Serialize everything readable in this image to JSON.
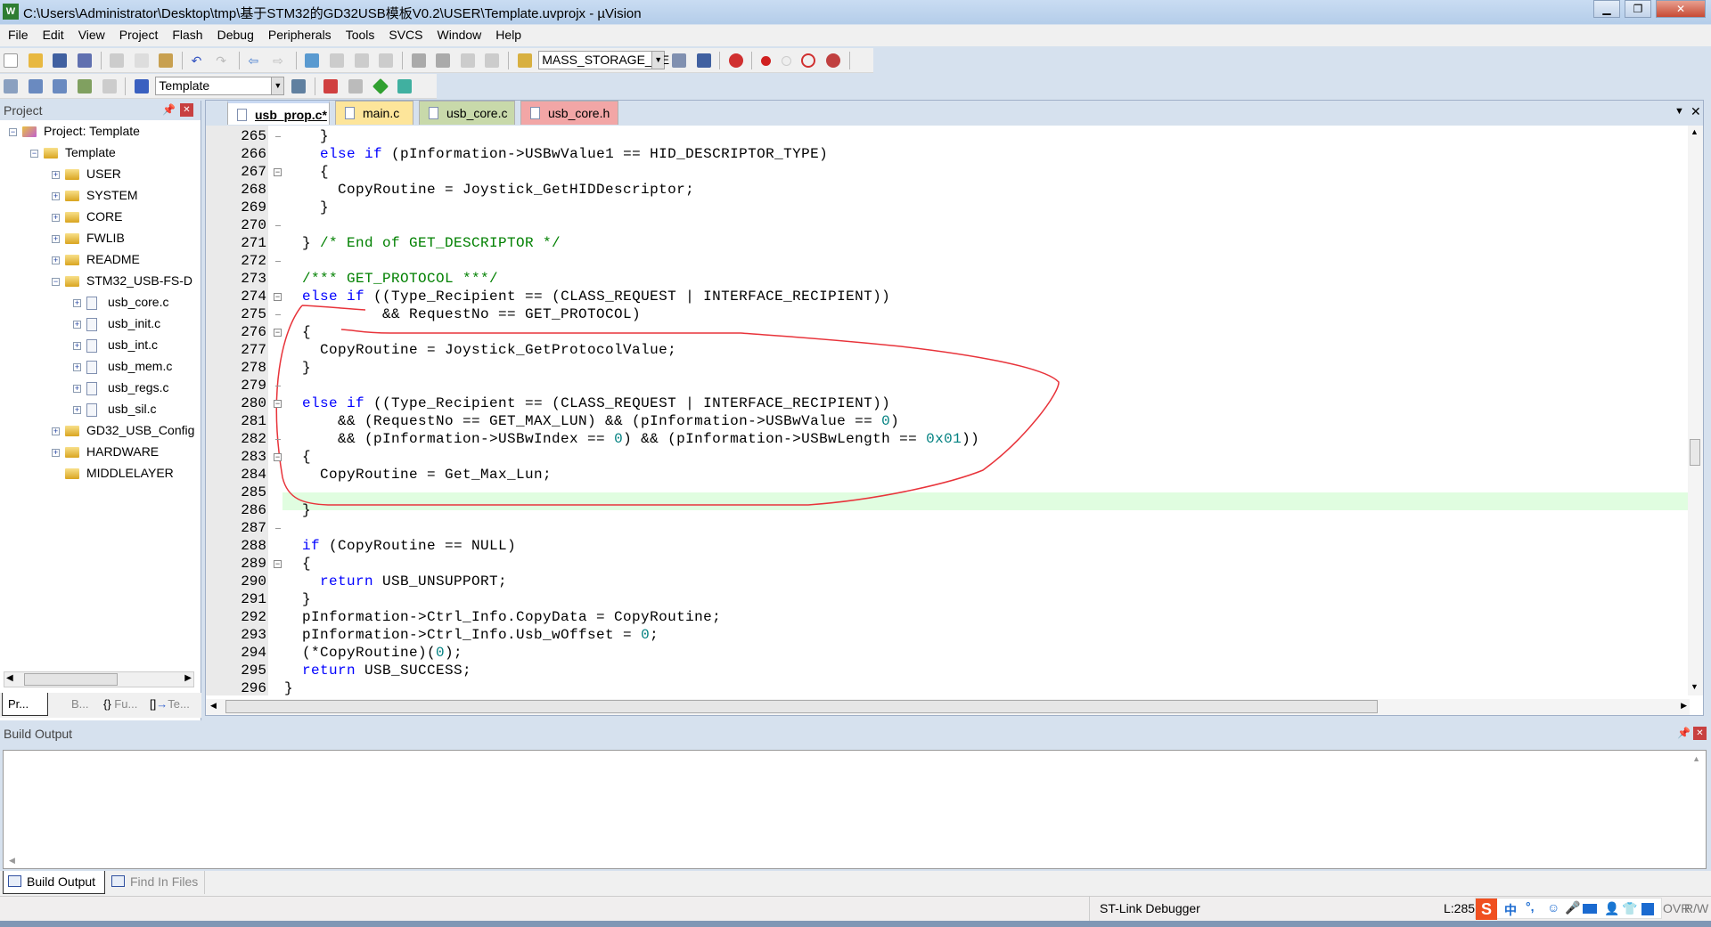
{
  "window": {
    "title": "C:\\Users\\Administrator\\Desktop\\tmp\\基于STM32的GD32USB模板V0.2\\USER\\Template.uvprojx - µVision",
    "app_icon": "W"
  },
  "menu": [
    "File",
    "Edit",
    "View",
    "Project",
    "Flash",
    "Debug",
    "Peripherals",
    "Tools",
    "SVCS",
    "Window",
    "Help"
  ],
  "toolbar": {
    "target_combo": "MASS_STORAGE_RE",
    "project_combo": "Template"
  },
  "project_panel": {
    "title": "Project",
    "tree": [
      {
        "label": "Project: Template",
        "level": 0,
        "expander": "−",
        "icon": "project"
      },
      {
        "label": "Template",
        "level": 1,
        "expander": "−",
        "icon": "folder"
      },
      {
        "label": "USER",
        "level": 2,
        "expander": "+",
        "icon": "folder"
      },
      {
        "label": "SYSTEM",
        "level": 2,
        "expander": "+",
        "icon": "folder"
      },
      {
        "label": "CORE",
        "level": 2,
        "expander": "+",
        "icon": "folder"
      },
      {
        "label": "FWLIB",
        "level": 2,
        "expander": "+",
        "icon": "folder"
      },
      {
        "label": "README",
        "level": 2,
        "expander": "+",
        "icon": "folder"
      },
      {
        "label": "STM32_USB-FS-D",
        "level": 2,
        "expander": "−",
        "icon": "folder"
      },
      {
        "label": "usb_core.c",
        "level": 3,
        "expander": "+",
        "icon": "file"
      },
      {
        "label": "usb_init.c",
        "level": 3,
        "expander": "+",
        "icon": "file"
      },
      {
        "label": "usb_int.c",
        "level": 3,
        "expander": "+",
        "icon": "file"
      },
      {
        "label": "usb_mem.c",
        "level": 3,
        "expander": "+",
        "icon": "file"
      },
      {
        "label": "usb_regs.c",
        "level": 3,
        "expander": "+",
        "icon": "file"
      },
      {
        "label": "usb_sil.c",
        "level": 3,
        "expander": "+",
        "icon": "file"
      },
      {
        "label": "GD32_USB_Config",
        "level": 2,
        "expander": "+",
        "icon": "folder"
      },
      {
        "label": "HARDWARE",
        "level": 2,
        "expander": "+",
        "icon": "folder"
      },
      {
        "label": "MIDDLELAYER",
        "level": 2,
        "expander": "",
        "icon": "folder"
      }
    ],
    "tabs": [
      "Pr...",
      "B...",
      "Fu...",
      "Te..."
    ]
  },
  "editor": {
    "tabs": [
      {
        "label": "usb_prop.c*",
        "color": "#c9d9f2",
        "active": true
      },
      {
        "label": "main.c",
        "color": "#fde59a"
      },
      {
        "label": "usb_core.c",
        "color": "#c8d9aa"
      },
      {
        "label": "usb_core.h",
        "color": "#f2a6a6"
      }
    ],
    "current_line": 285,
    "lines": [
      {
        "n": "265",
        "fold": "tick",
        "t": [
          [
            "",
            "    }"
          ]
        ]
      },
      {
        "n": "266",
        "t": [
          [
            "",
            "    "
          ],
          [
            "kw",
            "else if"
          ],
          [
            "",
            " (pInformation->USBwValue1 == HID_DESCRIPTOR_TYPE)"
          ]
        ]
      },
      {
        "n": "267",
        "fold": "box",
        "t": [
          [
            "",
            "    {"
          ]
        ]
      },
      {
        "n": "268",
        "t": [
          [
            "",
            "      CopyRoutine = Joystick_GetHIDDescriptor;"
          ]
        ]
      },
      {
        "n": "269",
        "t": [
          [
            "",
            "    }"
          ]
        ]
      },
      {
        "n": "270",
        "fold": "tick",
        "t": []
      },
      {
        "n": "271",
        "t": [
          [
            "",
            "  } "
          ],
          [
            "cm",
            "/* End of GET_DESCRIPTOR */"
          ]
        ]
      },
      {
        "n": "272",
        "fold": "tick",
        "t": []
      },
      {
        "n": "273",
        "t": [
          [
            "",
            "  "
          ],
          [
            "cm",
            "/*** GET_PROTOCOL ***/"
          ]
        ]
      },
      {
        "n": "274",
        "fold": "box",
        "t": [
          [
            "",
            "  "
          ],
          [
            "kw",
            "else if"
          ],
          [
            "",
            " ((Type_Recipient == (CLASS_REQUEST | INTERFACE_RECIPIENT))"
          ]
        ]
      },
      {
        "n": "275",
        "fold": "tick",
        "t": [
          [
            "",
            "           && RequestNo == GET_PROTOCOL)"
          ]
        ]
      },
      {
        "n": "276",
        "fold": "box",
        "t": [
          [
            "",
            "  {"
          ]
        ]
      },
      {
        "n": "277",
        "t": [
          [
            "",
            "    CopyRoutine = Joystick_GetProtocolValue;"
          ]
        ]
      },
      {
        "n": "278",
        "t": [
          [
            "",
            "  }"
          ]
        ]
      },
      {
        "n": "279",
        "fold": "tick",
        "t": []
      },
      {
        "n": "280",
        "fold": "box",
        "t": [
          [
            "",
            "  "
          ],
          [
            "kw",
            "else if"
          ],
          [
            "",
            " ((Type_Recipient == (CLASS_REQUEST | INTERFACE_RECIPIENT))"
          ]
        ]
      },
      {
        "n": "281",
        "t": [
          [
            "",
            "      && (RequestNo == GET_MAX_LUN) && (pInformation->USBwValue == "
          ],
          [
            "nm",
            "0"
          ],
          [
            "",
            ")"
          ]
        ]
      },
      {
        "n": "282",
        "fold": "tick",
        "t": [
          [
            "",
            "      && (pInformation->USBwIndex == "
          ],
          [
            "nm",
            "0"
          ],
          [
            "",
            ") && (pInformation->USBwLength == "
          ],
          [
            "nm",
            "0x01"
          ],
          [
            "",
            "))"
          ]
        ]
      },
      {
        "n": "283",
        "fold": "box",
        "t": [
          [
            "",
            "  {"
          ]
        ]
      },
      {
        "n": "284",
        "t": [
          [
            "",
            "    CopyRoutine = Get_Max_Lun;"
          ]
        ]
      },
      {
        "n": "285",
        "t": []
      },
      {
        "n": "286",
        "t": [
          [
            "",
            "  }"
          ]
        ]
      },
      {
        "n": "287",
        "fold": "tick",
        "t": []
      },
      {
        "n": "288",
        "t": [
          [
            "",
            "  "
          ],
          [
            "kw",
            "if"
          ],
          [
            "",
            " (CopyRoutine == NULL)"
          ]
        ]
      },
      {
        "n": "289",
        "fold": "box",
        "t": [
          [
            "",
            "  {"
          ]
        ]
      },
      {
        "n": "290",
        "t": [
          [
            "",
            "    "
          ],
          [
            "kw",
            "return"
          ],
          [
            "",
            " USB_UNSUPPORT;"
          ]
        ]
      },
      {
        "n": "291",
        "t": [
          [
            "",
            "  }"
          ]
        ]
      },
      {
        "n": "292",
        "t": [
          [
            "",
            "  pInformation->Ctrl_Info.CopyData = CopyRoutine;"
          ]
        ]
      },
      {
        "n": "293",
        "t": [
          [
            "",
            "  pInformation->Ctrl_Info.Usb_wOffset = "
          ],
          [
            "nm",
            "0"
          ],
          [
            "",
            ";"
          ]
        ]
      },
      {
        "n": "294",
        "t": [
          [
            "",
            "  (*CopyRoutine)("
          ],
          [
            "nm",
            "0"
          ],
          [
            "",
            ");"
          ]
        ]
      },
      {
        "n": "295",
        "t": [
          [
            "",
            "  "
          ],
          [
            "kw",
            "return"
          ],
          [
            "",
            " USB_SUCCESS;"
          ]
        ]
      },
      {
        "n": "296",
        "t": [
          [
            "",
            "}"
          ]
        ]
      }
    ],
    "colors": {
      "keyword": "#0000ff",
      "comment": "#008000",
      "number": "#008080",
      "annotation": "#e8333a",
      "current_line": "#e0fde0"
    }
  },
  "build": {
    "title": "Build Output",
    "tabs": [
      "Build Output",
      "Find In Files"
    ]
  },
  "status": {
    "debugger": "ST-Link Debugger",
    "position": "L:285",
    "ime": "中",
    "ovr": "OVR",
    "rw": "R/W"
  }
}
